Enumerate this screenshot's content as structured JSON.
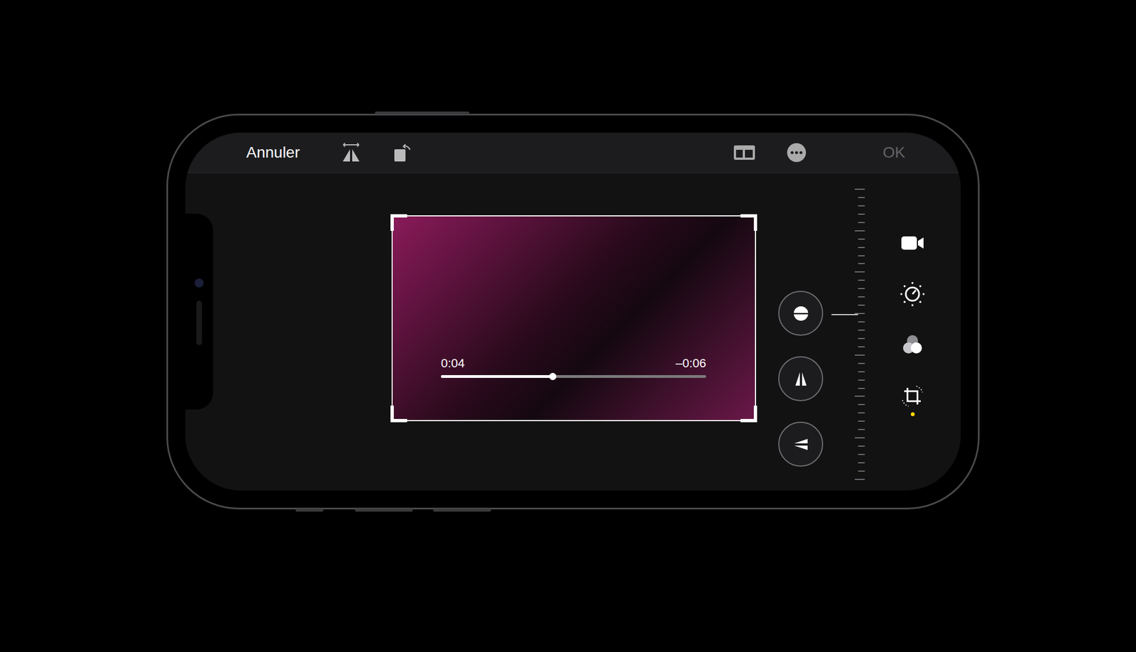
{
  "top_bar": {
    "cancel": {
      "label": "Annuler"
    },
    "done": {
      "label": "OK",
      "disabled": true
    }
  },
  "video": {
    "elapsed": "0:04",
    "remaining": "–0:06",
    "level": 0.42
  },
  "adjust_buttons": [
    {
      "kind": "straighten"
    },
    {
      "kind": "vertical"
    },
    {
      "kind": "horizontal"
    }
  ],
  "ruler": {
    "level": 0.43
  },
  "tools": [
    {
      "kind": "video",
      "selected": false
    },
    {
      "kind": "adjust",
      "selected": false
    },
    {
      "kind": "filters",
      "selected": false
    },
    {
      "kind": "crop",
      "selected": true
    }
  ]
}
